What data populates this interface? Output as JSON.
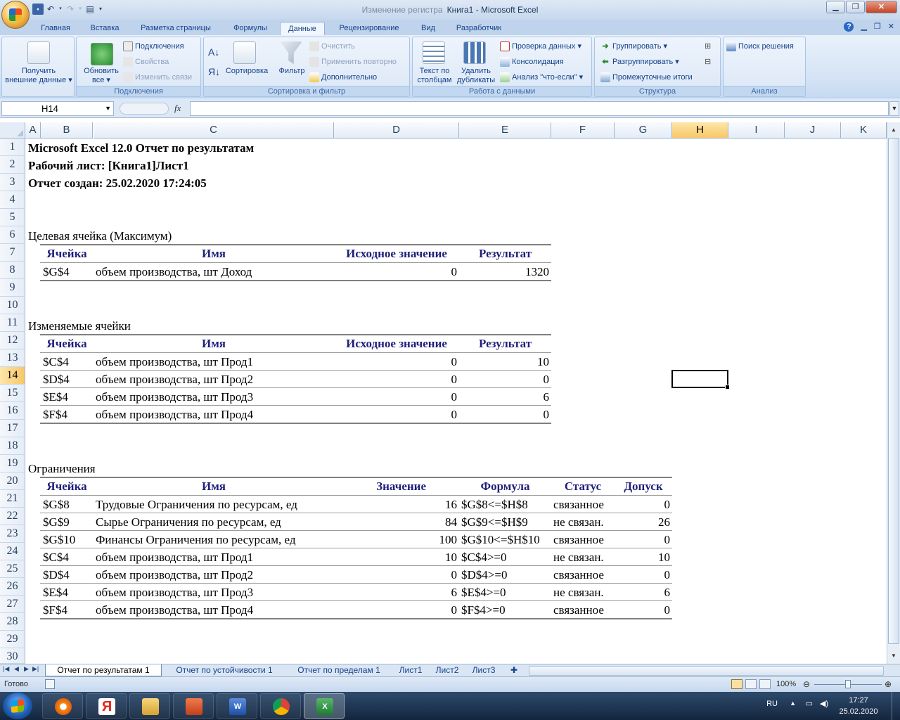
{
  "window": {
    "title_doc": "Книга1",
    "title_sep": " - ",
    "title_app": "Microsoft Excel",
    "title_hidden": "Изменение регистра"
  },
  "qat": {
    "save_icon": "save-icon",
    "undo_icon": "undo-icon",
    "redo_icon": "redo-icon",
    "form_icon": "form-icon"
  },
  "tabs": [
    "Главная",
    "Вставка",
    "Разметка страницы",
    "Формулы",
    "Данные",
    "Рецензирование",
    "Вид",
    "Разработчик"
  ],
  "active_tab": "Данные",
  "ribbon": {
    "external": {
      "label_line1": "Получить",
      "label_line2": "внешние данные ▾"
    },
    "connections": {
      "refresh_line1": "Обновить",
      "refresh_line2": "все ▾",
      "connections": "Подключения",
      "properties": "Свойства",
      "edit_links": "Изменить связи",
      "group": "Подключения"
    },
    "sort": {
      "sort": "Сортировка",
      "filter": "Фильтр",
      "clear": "Очистить",
      "reapply": "Применить повторно",
      "advanced": "Дополнительно",
      "group": "Сортировка и фильтр"
    },
    "datatools": {
      "text_line1": "Текст по",
      "text_line2": "столбцам",
      "dup_line1": "Удалить",
      "dup_line2": "дубликаты",
      "validation": "Проверка данных ▾",
      "consolidate": "Консолидация",
      "whatif": "Анализ \"что-если\" ▾",
      "group": "Работа с данными"
    },
    "outline": {
      "group_btn": "Группировать ▾",
      "ungroup": "Разгруппировать ▾",
      "subtotal": "Промежуточные итоги",
      "group": "Структура"
    },
    "analysis": {
      "solver": "Поиск решения",
      "group": "Анализ"
    }
  },
  "formula_bar": {
    "name_box": "H14",
    "fx": "fx",
    "value": ""
  },
  "columns": [
    "A",
    "B",
    "C",
    "D",
    "E",
    "F",
    "G",
    "H",
    "I",
    "J",
    "K"
  ],
  "selected_column": "H",
  "selected_row": "14",
  "rows": [
    "1",
    "2",
    "3",
    "4",
    "5",
    "6",
    "7",
    "8",
    "9",
    "10",
    "11",
    "12",
    "13",
    "14",
    "15",
    "16",
    "17",
    "18",
    "19",
    "20",
    "21",
    "22",
    "23",
    "24",
    "25",
    "26",
    "27",
    "28",
    "29",
    "30"
  ],
  "report": {
    "title1": "Microsoft Excel 12.0 Отчет по результатам",
    "title2": "Рабочий лист: [Книга1]Лист1",
    "title3": "Отчет создан: 25.02.2020 17:24:05",
    "target": {
      "heading": "Целевая ячейка (Максимум)",
      "headers": [
        "Ячейка",
        "Имя",
        "Исходное значение",
        "Результат"
      ],
      "rows": [
        [
          "$G$4",
          "объем производства, шт Доход",
          "0",
          "1320"
        ]
      ]
    },
    "changing": {
      "heading": "Изменяемые ячейки",
      "headers": [
        "Ячейка",
        "Имя",
        "Исходное значение",
        "Результат"
      ],
      "rows": [
        [
          "$C$4",
          "объем производства, шт Прод1",
          "0",
          "10"
        ],
        [
          "$D$4",
          "объем производства, шт Прод2",
          "0",
          "0"
        ],
        [
          "$E$4",
          "объем производства, шт Прод3",
          "0",
          "6"
        ],
        [
          "$F$4",
          "объем производства, шт Прод4",
          "0",
          "0"
        ]
      ]
    },
    "constraints": {
      "heading": "Ограничения",
      "headers": [
        "Ячейка",
        "Имя",
        "Значение",
        "Формула",
        "Статус",
        "Допуск"
      ],
      "rows": [
        [
          "$G$8",
          "Трудовые Ограничения по ресурсам, ед",
          "16",
          "$G$8<=$H$8",
          "связанное",
          "0"
        ],
        [
          "$G$9",
          "Сырье Ограничения по ресурсам, ед",
          "84",
          "$G$9<=$H$9",
          "не связан.",
          "26"
        ],
        [
          "$G$10",
          "Финансы Ограничения по ресурсам, ед",
          "100",
          "$G$10<=$H$10",
          "связанное",
          "0"
        ],
        [
          "$C$4",
          "объем производства, шт Прод1",
          "10",
          "$C$4>=0",
          "не связан.",
          "10"
        ],
        [
          "$D$4",
          "объем производства, шт Прод2",
          "0",
          "$D$4>=0",
          "связанное",
          "0"
        ],
        [
          "$E$4",
          "объем производства, шт Прод3",
          "6",
          "$E$4>=0",
          "не связан.",
          "6"
        ],
        [
          "$F$4",
          "объем производства, шт Прод4",
          "0",
          "$F$4>=0",
          "связанное",
          "0"
        ]
      ]
    }
  },
  "sheets": [
    "Отчет по результатам 1",
    "Отчет по устойчивости 1",
    "Отчет по пределам 1",
    "Лист1",
    "Лист2",
    "Лист3"
  ],
  "active_sheet": "Отчет по результатам 1",
  "status": {
    "ready": "Готово",
    "zoom": "100%"
  },
  "taskbar": {
    "apps": [
      "settings-app",
      "yandex-browser",
      "file-explorer",
      "powerpoint",
      "word",
      "chrome",
      "excel"
    ],
    "lang": "RU",
    "time": "17:27",
    "date": "25.02.2020"
  }
}
